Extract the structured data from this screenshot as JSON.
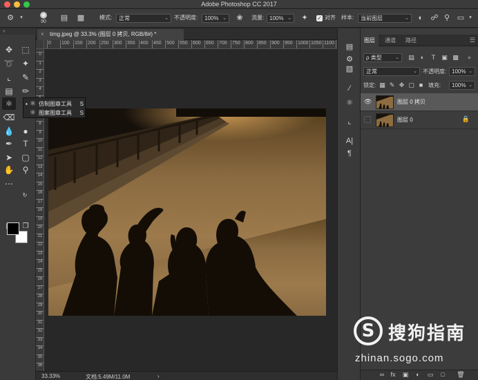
{
  "app": {
    "title": "Adobe Photoshop CC 2017"
  },
  "options_bar": {
    "brush_size": "90",
    "mode_label": "模式:",
    "mode_value": "正常",
    "opacity_label": "不透明度:",
    "opacity_value": "100%",
    "flow_label": "流量:",
    "flow_value": "100%",
    "align_label": "对齐",
    "sample_label": "样本:",
    "sample_value": "当前图层"
  },
  "tool_flyout": {
    "items": [
      {
        "label": "仿制图章工具",
        "shortcut": "S",
        "selected": true
      },
      {
        "label": "图案图章工具",
        "shortcut": "S",
        "selected": false
      }
    ]
  },
  "document": {
    "tab_title": "timg.jpeg @ 33.3% (图层 0 拷贝, RGB/8#) *",
    "close_glyph": "×"
  },
  "rulers": {
    "horizontal_ticks": [
      "0",
      "100",
      "150",
      "200",
      "250",
      "300",
      "350",
      "400",
      "450",
      "500",
      "550",
      "600",
      "650",
      "700",
      "750",
      "800",
      "850",
      "900",
      "950",
      "1000",
      "1050",
      "1100",
      "1150"
    ],
    "vertical_ticks": [
      "0",
      "1",
      "2",
      "3",
      "4",
      "5",
      "6",
      "7",
      "8",
      "9",
      "10",
      "11",
      "12",
      "13",
      "14",
      "15",
      "16",
      "17",
      "18",
      "19",
      "20",
      "21",
      "22",
      "23",
      "24",
      "25",
      "26",
      "27",
      "28",
      "29",
      "30",
      "31",
      "32",
      "33",
      "34",
      "35",
      "36"
    ]
  },
  "status_bar": {
    "zoom": "33.33%",
    "doc_info": "文档:5.49M/11.0M",
    "arrow": "›"
  },
  "layers_panel": {
    "tabs": [
      "图层",
      "通道",
      "路径"
    ],
    "active_tab": "图层",
    "filter_label": "ρ 类型",
    "blend_mode": "正常",
    "opacity_label": "不透明度:",
    "opacity_value": "100%",
    "lock_label": "锁定:",
    "fill_label": "填充:",
    "fill_value": "100%",
    "layers": [
      {
        "name": "图层 0 拷贝",
        "visible": true,
        "selected": true,
        "locked": false
      },
      {
        "name": "图层 0",
        "visible": false,
        "selected": false,
        "locked": true
      }
    ],
    "bottom_icons": [
      "link-icon",
      "fx-icon",
      "mask-icon",
      "adjustment-icon",
      "group-icon",
      "new-layer-icon",
      "trash-icon"
    ]
  },
  "watermark": {
    "logo_letter": "S",
    "name": "搜狗指南",
    "url": "zhinan.sogo.com"
  },
  "colors": {
    "foreground": "#000000",
    "background": "#ffffff",
    "traffic_red": "#fc605c",
    "traffic_yellow": "#fdbc40",
    "traffic_green": "#34c84a"
  }
}
